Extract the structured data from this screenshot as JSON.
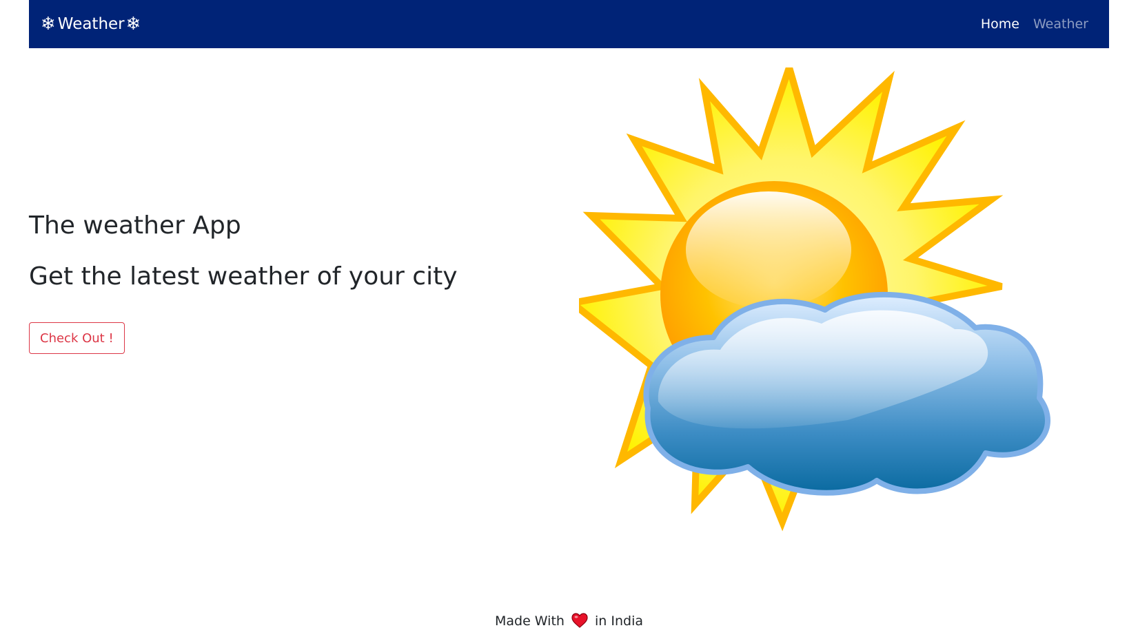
{
  "navbar": {
    "brand": "Weather",
    "brand_icon": "snowflake-icon",
    "links": [
      {
        "label": "Home",
        "active": true
      },
      {
        "label": "Weather",
        "active": false
      }
    ],
    "background": "#002377"
  },
  "hero": {
    "title": "The weather App",
    "subtitle": "Get the latest weather of your city",
    "cta_label": "Check Out !",
    "cta_color": "#dc3545",
    "image": "sun-behind-cloud-illustration"
  },
  "footer": {
    "before": "Made With",
    "icon": "heart-icon",
    "after": "in India"
  }
}
